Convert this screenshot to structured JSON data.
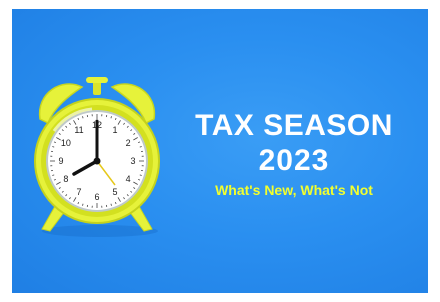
{
  "banner": {
    "title_line1": "TAX SEASON",
    "title_line2": "2023",
    "subtitle": "What's New, What's Not",
    "background_color": "#2a8ff0",
    "title_color": "#ffffff",
    "subtitle_color": "#f2ff2e"
  },
  "clock": {
    "icon": "alarm-clock-icon",
    "color": "#e6f23a",
    "time_shown": "8:00",
    "dial_numbers": [
      "12",
      "1",
      "2",
      "3",
      "4",
      "5",
      "6",
      "7",
      "8",
      "9",
      "10",
      "11"
    ]
  }
}
